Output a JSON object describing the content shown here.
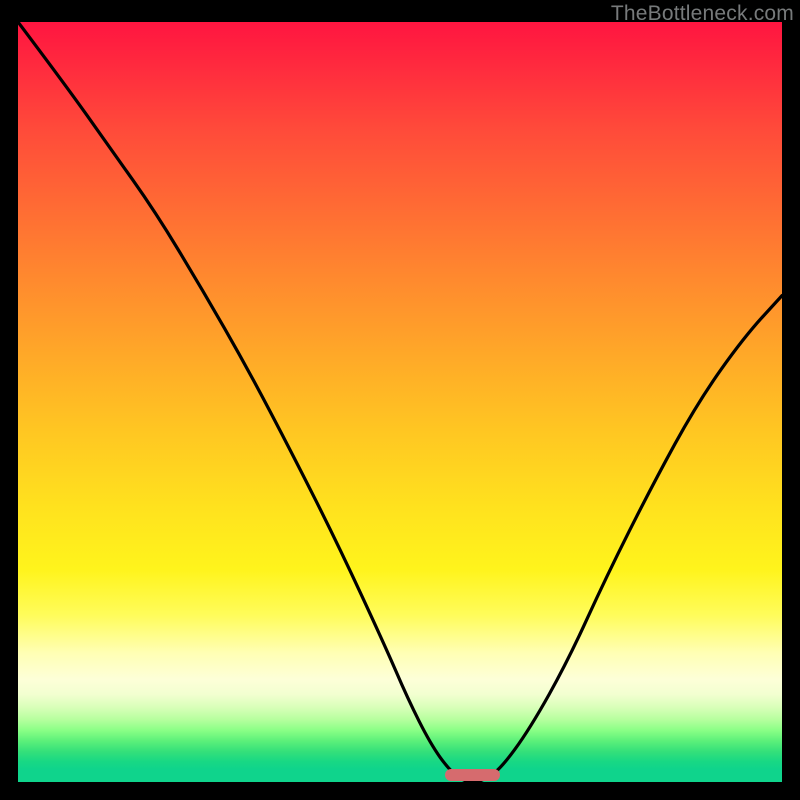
{
  "watermark": "TheBottleneck.com",
  "colors": {
    "curve": "#000000",
    "marker": "#d66b6e",
    "background": "#000000"
  },
  "chart_data": {
    "type": "line",
    "title": "",
    "xlabel": "",
    "ylabel": "",
    "xlim": [
      0,
      100
    ],
    "ylim": [
      0,
      100
    ],
    "x": [
      0,
      6,
      12,
      18,
      24,
      30,
      36,
      42,
      48,
      51,
      54,
      56.5,
      58.5,
      60.5,
      63,
      67,
      72,
      77,
      83,
      89,
      95,
      100
    ],
    "y": [
      100,
      92,
      83.5,
      75,
      65,
      54.5,
      43,
      31,
      18,
      11,
      5,
      1.5,
      0,
      0,
      1.5,
      7,
      16,
      27,
      39,
      50,
      58.5,
      64
    ],
    "note": "x and y are percentages of the plot width/height from the bottom-left. Curve represents bottleneck % vs configuration; minimum near x≈59.",
    "marker": {
      "x_center_pct": 59.5,
      "width_pct": 7.2,
      "y_from_bottom_pct": 0.9
    },
    "gradient_scale": {
      "direction": "vertical",
      "stops": [
        {
          "pct": 0,
          "color": "#ff1540",
          "meaning": "high bottleneck"
        },
        {
          "pct": 50,
          "color": "#ffc722"
        },
        {
          "pct": 85,
          "color": "#ffffb4"
        },
        {
          "pct": 100,
          "color": "#0fd48c",
          "meaning": "no bottleneck"
        }
      ]
    }
  }
}
